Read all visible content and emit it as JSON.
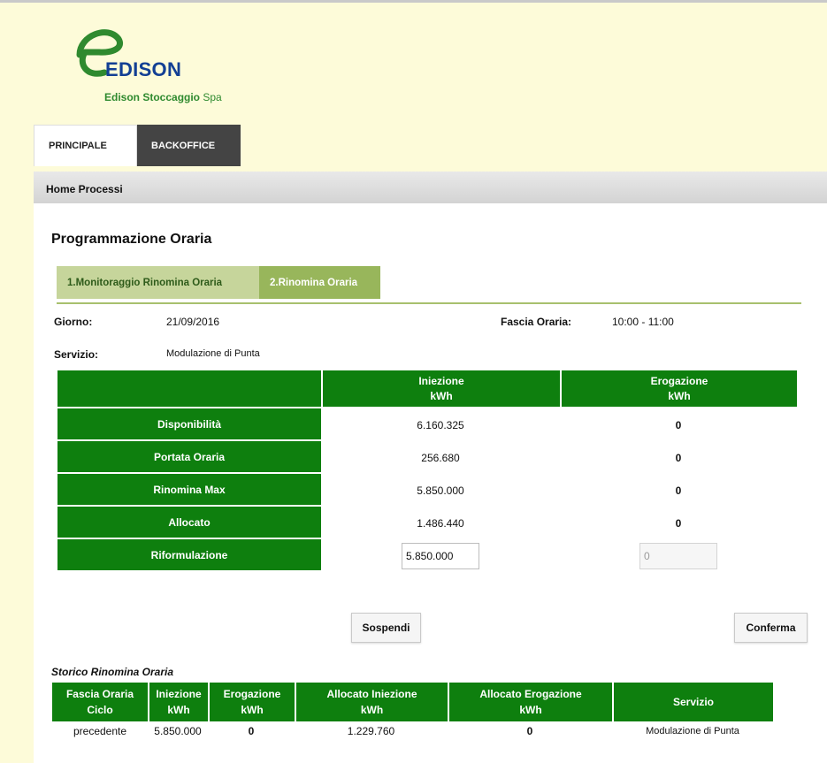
{
  "brand": {
    "name": "EDISON",
    "subtitle_bold": "Edison Stoccaggio",
    "subtitle_rest": " Spa",
    "colors": {
      "blue": "#123f94",
      "green": "#2f8a2f"
    }
  },
  "tabs": [
    {
      "label": "PRINCIPALE"
    },
    {
      "label": "BACKOFFICE"
    }
  ],
  "breadcrumb": "Home Processi",
  "page_title": "Programmazione Oraria",
  "steps": [
    {
      "label": "1.Monitoraggio Rinomina Oraria"
    },
    {
      "label": "2.Rinomina Oraria"
    }
  ],
  "info": {
    "giorno_label": "Giorno:",
    "giorno_value": "21/09/2016",
    "fascia_label": "Fascia Oraria:",
    "fascia_value": "10:00 - 11:00",
    "servizio_label": "Servizio:",
    "servizio_value": "Modulazione di Punta"
  },
  "main_table": {
    "headers": [
      {
        "line1": "",
        "line2": ""
      },
      {
        "line1": "Iniezione",
        "line2": "kWh"
      },
      {
        "line1": "Erogazione",
        "line2": "kWh"
      }
    ],
    "rows": [
      {
        "label": "Disponibilità",
        "iniezione": "6.160.325",
        "erogazione": "0"
      },
      {
        "label": "Portata Oraria",
        "iniezione": "256.680",
        "erogazione": "0"
      },
      {
        "label": "Rinomina Max",
        "iniezione": "5.850.000",
        "erogazione": "0"
      },
      {
        "label": "Allocato",
        "iniezione": "1.486.440",
        "erogazione": "0"
      }
    ],
    "input_row": {
      "label": "Riformulazione",
      "iniezione_value": "5.850.000",
      "erogazione_value": "0"
    },
    "accent_color": "#0e7f0e"
  },
  "buttons": {
    "sospendi": "Sospendi",
    "conferma": "Conferma"
  },
  "history": {
    "title": "Storico Rinomina Oraria",
    "headers": [
      {
        "line1": "Fascia Oraria",
        "line2": "Ciclo"
      },
      {
        "line1": "Iniezione",
        "line2": "kWh"
      },
      {
        "line1": "Erogazione",
        "line2": "kWh"
      },
      {
        "line1": "Allocato Iniezione",
        "line2": "kWh"
      },
      {
        "line1": "Allocato Erogazione",
        "line2": "kWh"
      },
      {
        "line1": "Servizio",
        "line2": ""
      }
    ],
    "rows": [
      [
        "precedente",
        "5.850.000",
        "0",
        "1.229.760",
        "0",
        "Modulazione di Punta"
      ]
    ]
  }
}
